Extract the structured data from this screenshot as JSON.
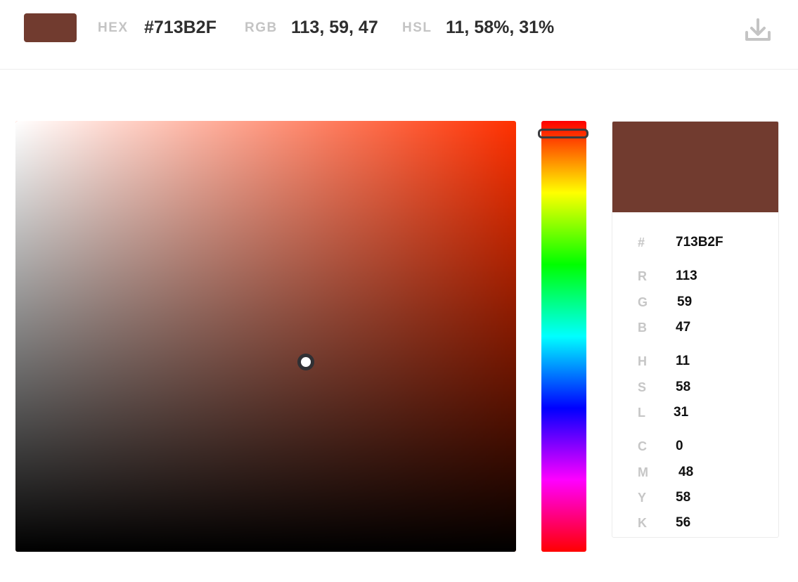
{
  "color": {
    "hex": "#713B2F",
    "hue_color": "#ff3000",
    "saturation_fraction": 0.58,
    "value_fraction": 0.44,
    "hue_fraction": 0.03
  },
  "topbar": {
    "hex_label": "HEX",
    "hex_value": "#713B2F",
    "rgb_label": "RGB",
    "rgb_value": "113, 59, 47",
    "hsl_label": "HSL",
    "hsl_value": "11, 58%, 31%",
    "download_icon": "download-icon"
  },
  "panel": {
    "hex_label": "#",
    "hex_value": "713B2F",
    "rgb": [
      {
        "label": "R",
        "value": "113"
      },
      {
        "label": "G",
        "value": "59"
      },
      {
        "label": "B",
        "value": "47"
      }
    ],
    "hsl": [
      {
        "label": "H",
        "value": "11"
      },
      {
        "label": "S",
        "value": "58"
      },
      {
        "label": "L",
        "value": "31"
      }
    ],
    "cmyk": [
      {
        "label": "C",
        "value": "0"
      },
      {
        "label": "M",
        "value": "48"
      },
      {
        "label": "Y",
        "value": "58"
      },
      {
        "label": "K",
        "value": "56"
      }
    ]
  }
}
